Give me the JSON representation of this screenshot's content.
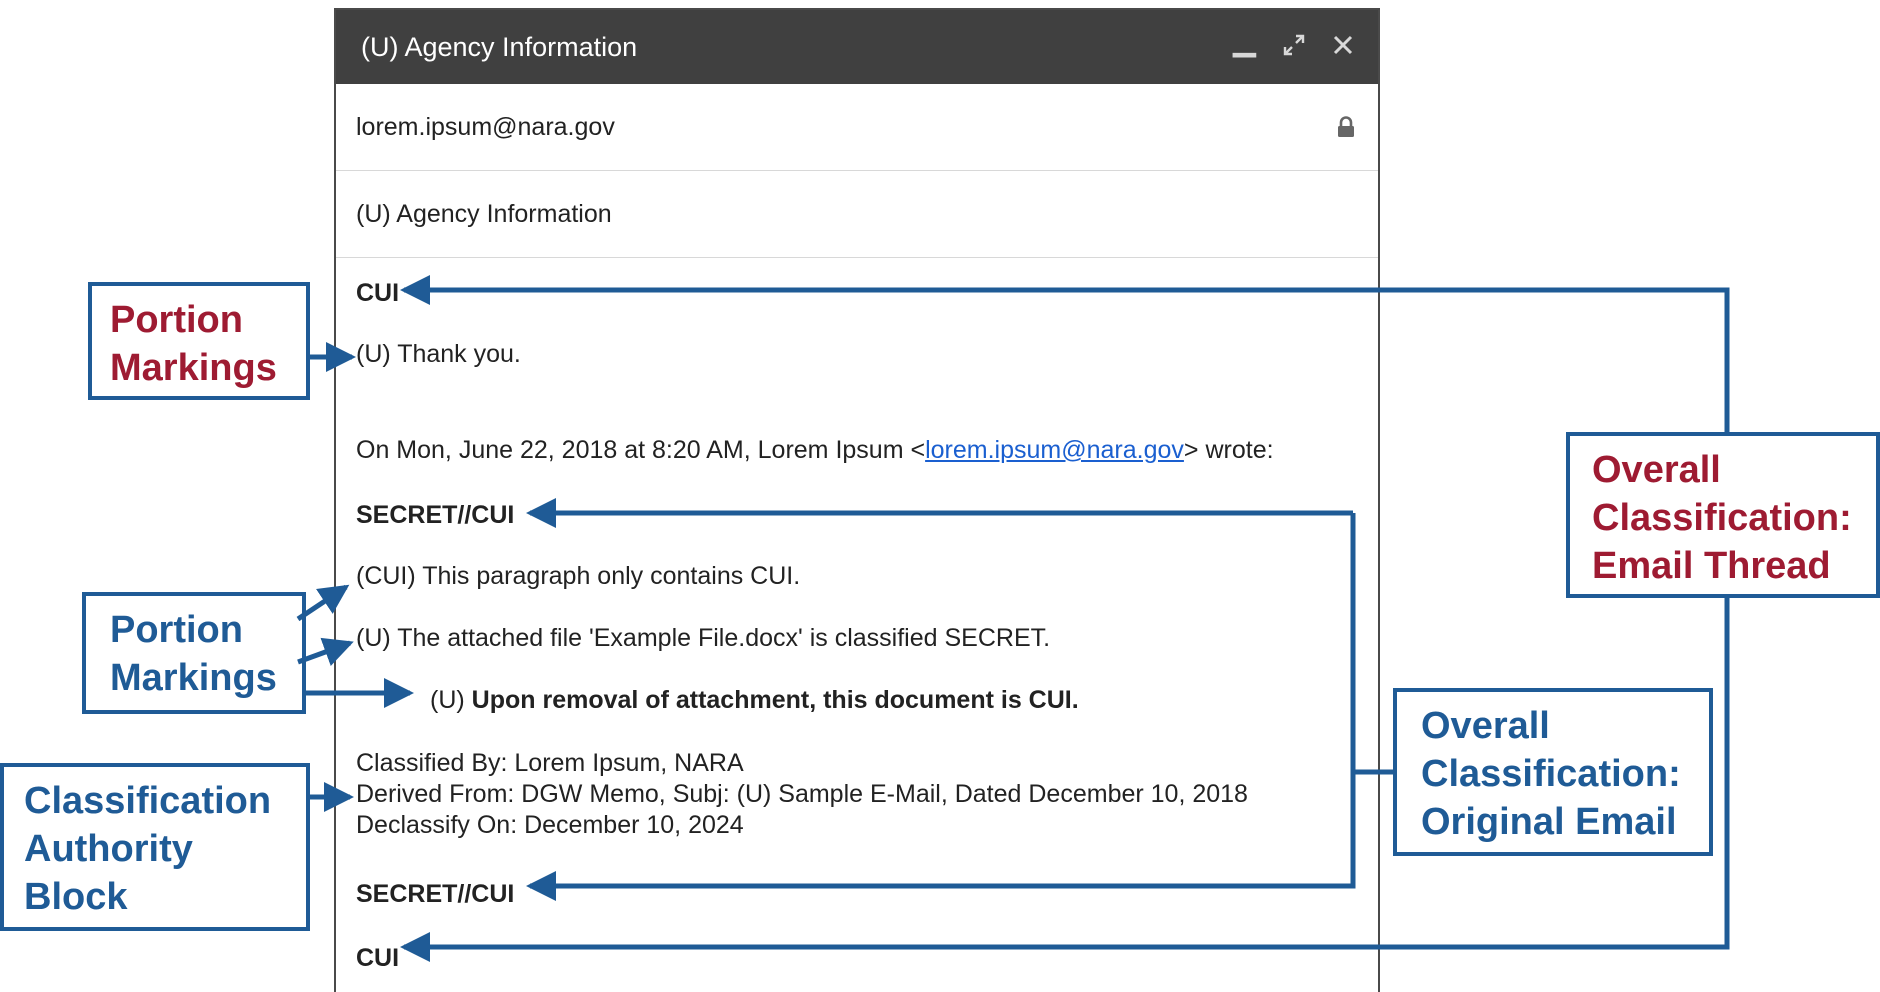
{
  "window": {
    "title": "(U) Agency Information",
    "to_value": "lorem.ipsum@nara.gov",
    "subject_value": "(U) Agency Information"
  },
  "body": {
    "top_marking": "CUI",
    "reply_line": "(U) Thank you.",
    "quote_header_prefix": "On Mon, June 22, 2018 at 8:20 AM, Lorem Ipsum  <",
    "quote_header_link": "lorem.ipsum@nara.gov",
    "quote_header_suffix": "> wrote:",
    "orig_top_marking": "SECRET//CUI",
    "para_cui": "(CUI) This paragraph only contains CUI.",
    "para_attached": "(U) The attached file 'Example File.docx' is classified SECRET.",
    "removal_prefix": "(U) ",
    "removal_text": "Upon removal of attachment, this document is CUI.",
    "classified_by": "Classified By: Lorem Ipsum, NARA",
    "derived_from": "Derived From: DGW Memo, Subj: (U) Sample E-Mail, Dated December 10, 2018",
    "declassify_on": "Declassify On: December 10, 2024",
    "orig_bottom_marking": "SECRET//CUI",
    "bottom_marking": "CUI"
  },
  "callouts": {
    "portion_markings_1": [
      "Portion",
      "Markings"
    ],
    "portion_markings_2": [
      "Portion",
      "Markings"
    ],
    "classification_authority": [
      "Classification",
      "Authority",
      "Block"
    ],
    "overall_thread": [
      "Overall",
      "Classification:",
      "Email Thread"
    ],
    "overall_original": [
      "Overall",
      "Classification:",
      "Original Email"
    ]
  },
  "colors": {
    "callout_border": "#1f5b96",
    "callout_red_text": "#9e1b32",
    "callout_blue_text": "#1f5b96",
    "titlebar": "#404040",
    "link": "#1a5fd0"
  },
  "icons": {
    "minimize": "minimize-icon",
    "expand": "expand-icon",
    "close": "close-icon",
    "lock": "lock-icon"
  }
}
